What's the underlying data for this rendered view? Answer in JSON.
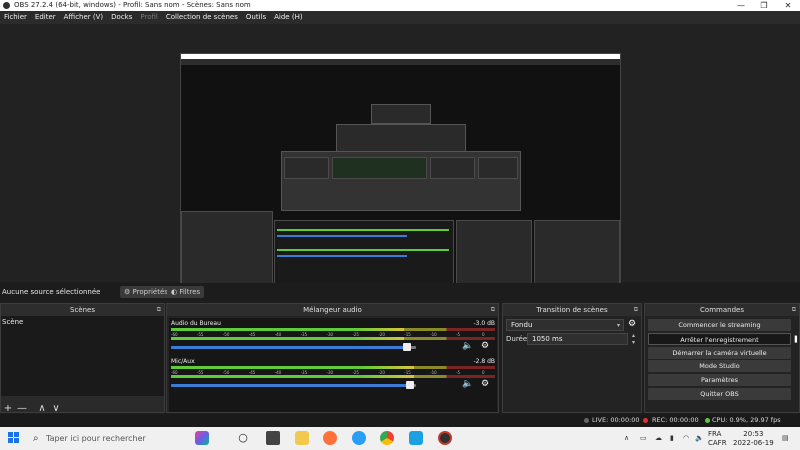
{
  "window": {
    "title": "OBS 27.2.4 (64-bit, windows) - Profil: Sans nom - Scènes: Sans nom",
    "controls": [
      "—",
      "❐",
      "✕"
    ]
  },
  "menu": [
    {
      "label": "Fichier",
      "enabled": true
    },
    {
      "label": "Editer",
      "enabled": true
    },
    {
      "label": "Afficher (V)",
      "enabled": true
    },
    {
      "label": "Docks",
      "enabled": true
    },
    {
      "label": "Profil",
      "enabled": false
    },
    {
      "label": "Collection de scènes",
      "enabled": true
    },
    {
      "label": "Outils",
      "enabled": true
    },
    {
      "label": "Aide (H)",
      "enabled": true
    }
  ],
  "sourcebar": {
    "no_source": "Aucune source sélectionnée",
    "properties": "Propriétés",
    "filters": "Filtres"
  },
  "scenes": {
    "title": "Scènes",
    "items": [
      "Scène"
    ],
    "tools": [
      "+",
      "—",
      "∧",
      "∨"
    ]
  },
  "mixer": {
    "title": "Mélangeur audio",
    "ticks": [
      "-60",
      "-55",
      "-50",
      "-45",
      "-40",
      "-35",
      "-30",
      "-25",
      "-20",
      "-15",
      "-10",
      "-5",
      "0"
    ],
    "tracks": [
      {
        "name": "Audio du Bureau",
        "db": "-3.0 dB",
        "level": 0.72,
        "volume": 0.98
      },
      {
        "name": "Mic/Aux",
        "db": "-2.8 dB",
        "level": 0.75,
        "volume": 0.99
      }
    ]
  },
  "transitions": {
    "title": "Transition de scènes",
    "type": "Fondu",
    "duration_label": "Durée",
    "duration_value": "1050 ms"
  },
  "commands": {
    "title": "Commandes",
    "buttons": [
      "Commencer le streaming",
      "Arrêter l'enregistrement",
      "Démarrer la caméra virtuelle",
      "Mode Studio",
      "Paramètres",
      "Quitter OBS"
    ],
    "pause": "❚❚"
  },
  "status": {
    "live": "LIVE: 00:00:00",
    "rec": "REC: 00:00:00",
    "cpu": "CPU: 0.9%, 29.97 fps"
  },
  "taskbar": {
    "search_placeholder": "Taper ici pour rechercher",
    "lang_line1": "FRA",
    "lang_line2": "CAFR",
    "time": "20:53",
    "date": "2022-06-19"
  },
  "colors": {
    "accent_blue": "#3a7bd5",
    "rec_red": "#e03030",
    "meter_green": "#5ecb3a"
  }
}
